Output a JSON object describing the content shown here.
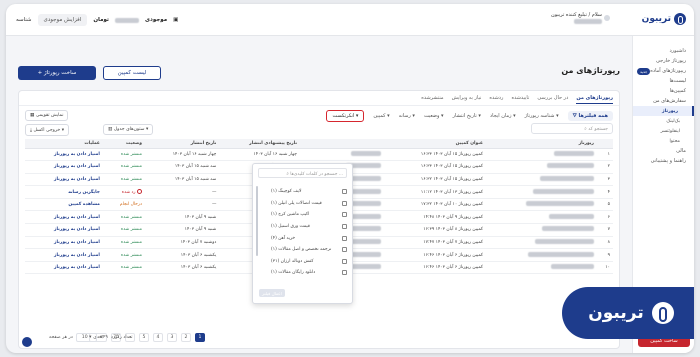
{
  "brand": {
    "name": "تریبون",
    "overlay_name": "تریبون"
  },
  "topbar": {
    "user_line1": "سلام / تبلیغ کننده تریبون",
    "user_line2": "موجودی",
    "balance_label": "موجودی",
    "currency": "تومان",
    "support_button": "افزایش موجودی",
    "account_type": "شناسه"
  },
  "sidebar": {
    "items": [
      {
        "label": "داشبورد"
      },
      {
        "label": "رپورتاژ خارجی"
      },
      {
        "label": "ریپورتاژهای آماده",
        "badge": "جدید"
      },
      {
        "label": "لیست‌ها"
      },
      {
        "label": "کمپین‌ها"
      },
      {
        "label": "سفارش‌های من"
      },
      {
        "label": "رپورتاژ",
        "active": true
      },
      {
        "label": "بک‌لینک"
      },
      {
        "label": "اینفلوئنسر"
      },
      {
        "label": "محتوا"
      },
      {
        "label": "مالی"
      },
      {
        "label": "راهنما و پشتیبانی"
      }
    ],
    "cta": "ساخت کمپین"
  },
  "header": {
    "title": "رپورتاژهای من",
    "create_button": "+ ساخت رپورتاژ",
    "campaign_list_button": "لیست کمپین"
  },
  "tabs": [
    "رپورتاژهای من",
    "در حال بررسی",
    "تاییدشده",
    "ردشده",
    "نیاز به ویرایش",
    "منتشرشده"
  ],
  "filters": {
    "all": "همه فیلترها",
    "items": [
      "شناسه رپورتاژ",
      "زمان ایجاد",
      "تاریخ انتشار",
      "وضعیت",
      "رسانه",
      "کمپین"
    ],
    "highlighted": "انکرتکست"
  },
  "tools": {
    "calendar_view": "نمایش تقویمی",
    "columns": "ستون‌های جدول",
    "export": "خروجی اکسل"
  },
  "search": {
    "placeholder": "جستجو کد"
  },
  "table": {
    "columns": [
      "",
      "رپورتاژ",
      "عنوان کمپین",
      "",
      "تاریخ پیشنهادی انتشار",
      "تاریخ انتشار",
      "وضعیت",
      "عملیات"
    ],
    "rows": [
      {
        "n": "۱",
        "campaign": "کمپین رپورتاژ ۱۵ آبان ۱۴۰۳",
        "time": "۱۶:۳۳",
        "suggested": "چهار شنبه ۱۶ آبان ۱۴۰۳",
        "published": "چهار شنبه ۱۶ آبان ۱۴۰۳",
        "status": "منتشر شده",
        "status_kind": "ok",
        "action": "امتیاز دادن به رپورتاژ"
      },
      {
        "n": "۲",
        "campaign": "کمپین رپورتاژ ۱۵ آبان ۱۴۰۳",
        "time": "۱۶:۳۳",
        "suggested": "سه شنبه ۱۵ آبان ۱۴۰۳",
        "published": "سه شنبه ۱۵ آبان ۱۴۰۳",
        "status": "منتشر شده",
        "status_kind": "ok",
        "action": "امتیاز دادن به رپورتاژ"
      },
      {
        "n": "۳",
        "campaign": "کمپین رپورتاژ ۱۵ آبان ۱۴۰۳",
        "time": "۱۶:۳۲",
        "suggested": "سه شنبه ۱۵ آبان ۱۴۰۳",
        "published": "سه شنبه ۱۵ آبان ۱۴۰۳",
        "status": "منتشر شده",
        "status_kind": "ok",
        "action": "امتیاز دادن به رپورتاژ"
      },
      {
        "n": "۴",
        "campaign": "کمپین رپورتاژ ۱۳ آبان ۱۴۰۳",
        "time": "۱۱:۱۲",
        "suggested": "سه شنبه ۷ آبان ۱۴۰۳",
        "published": "—",
        "status": "رد شده",
        "status_kind": "bad",
        "action": "جایگزین رسانه"
      },
      {
        "n": "۵",
        "campaign": "کمپین رپورتاژ ۱۰ آبان ۱۴۰۳",
        "time": "۱۷:۳۲",
        "suggested": "جمعه ۱۱ آبان ۱۴۰۳",
        "published": "—",
        "status": "درحال انجام",
        "status_kind": "ongoing",
        "action": "مشاهده کمپین"
      },
      {
        "n": "۶",
        "campaign": "کمپین رپورتاژ ۹ آبان ۱۴۰۳",
        "time": "۱۴:۴۸",
        "suggested": "شنبه ۱۰ آبان ۱۴۰۳",
        "published": "شنبه ۹ آبان ۱۴۰۳",
        "status": "منتشر شده",
        "status_kind": "ok",
        "action": "امتیاز دادن به رپورتاژ"
      },
      {
        "n": "۷",
        "campaign": "کمپین رپورتاژ ۸ آبان ۱۴۰۳",
        "time": "۱۶:۳۹",
        "suggested": "دوشنبه ۷ آبان ۱۴۰۳",
        "published": "شنبه ۹ آبان ۱۴۰۳",
        "status": "منتشر شده",
        "status_kind": "ok",
        "action": "امتیاز دادن به رپورتاژ"
      },
      {
        "n": "۸",
        "campaign": "کمپین رپورتاژ ۷ آبان ۱۴۰۳",
        "time": "۱۷:۴۷",
        "suggested": "دوشنبه ۷ آبان ۱۴۰۳",
        "published": "دوشنبه ۷ آبان ۱۴۰۳",
        "status": "منتشر شده",
        "status_kind": "ok",
        "action": "امتیاز دادن به رپورتاژ"
      },
      {
        "n": "۹",
        "campaign": "کمپین رپورتاژ ۶ آبان ۱۴۰۳",
        "time": "۱۶:۴۶",
        "suggested": "یکشنبه ۶ آبان ۱۴۰۳",
        "published": "یکشنبه ۶ آبان ۱۴۰۳",
        "status": "منتشر شده",
        "status_kind": "ok",
        "action": "امتیاز دادن به رپورتاژ"
      },
      {
        "n": "۱۰",
        "campaign": "کمپین رپورتاژ ۶ آبان ۱۴۰۳",
        "time": "۱۶:۴۶",
        "suggested": "یکشنبه ۶ آبان ۱۴۰۳",
        "published": "یکشنبه ۶ آبان ۱۴۰۳",
        "status": "منتشر شده",
        "status_kind": "ok",
        "action": "امتیاز دادن به رپورتاژ"
      }
    ]
  },
  "dropdown": {
    "search_placeholder": "جستجو در کلمات کلیدی‌ها ...",
    "options": [
      {
        "label": "لایف کوچینگ",
        "count": "(۱)"
      },
      {
        "label": "قیمت اتصالات پلی اتیلن",
        "count": "(۱)"
      },
      {
        "label": "اکیپ ماشین کرج",
        "count": "(۱)"
      },
      {
        "label": "قیمت ورق استیل",
        "count": "(۱)"
      },
      {
        "label": "خرید آهن",
        "count": "(۴)"
      },
      {
        "label": "ترجمه تخصص و اصل مقالات",
        "count": "(۱)"
      },
      {
        "label": "کفش دوناله ارزان",
        "count": "(۳۱)"
      },
      {
        "label": "دانلود رایگان مقالات",
        "count": "(۱)"
      }
    ],
    "apply": "اعمال فیلتر"
  },
  "pagination": {
    "pages": [
      "1",
      "2",
      "3",
      "4",
      "5",
      "...",
      "75"
    ],
    "next": "بعدی",
    "total_label": "تعداد رکورد",
    "total": "۷۴۹",
    "per_page_label": "در هر صفحه",
    "per_page": "10"
  },
  "colors": {
    "brand": "#1e3c8c",
    "danger": "#c6262e",
    "success": "#2e8b57"
  }
}
